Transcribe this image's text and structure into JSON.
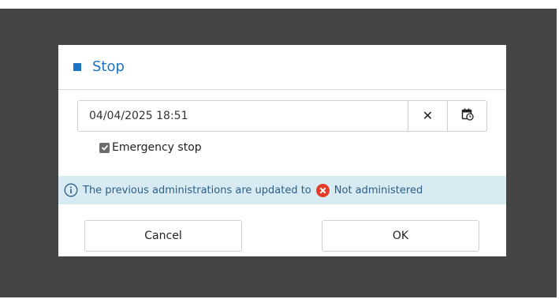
{
  "dialog": {
    "title": "Stop",
    "accent_color": "#1b74c6"
  },
  "datetime": {
    "value": "04/04/2025 18:51",
    "clear_icon": "close-icon",
    "calendar_icon": "calendar-clock-icon"
  },
  "emergency": {
    "label": "Emergency stop",
    "checked": true
  },
  "info": {
    "icon": "info-icon",
    "text": "The previous administrations are updated to",
    "status_icon": "error-circle-icon",
    "status_text": "Not administered",
    "background": "#d8ebf3"
  },
  "buttons": {
    "cancel_label": "Cancel",
    "ok_label": "OK"
  }
}
